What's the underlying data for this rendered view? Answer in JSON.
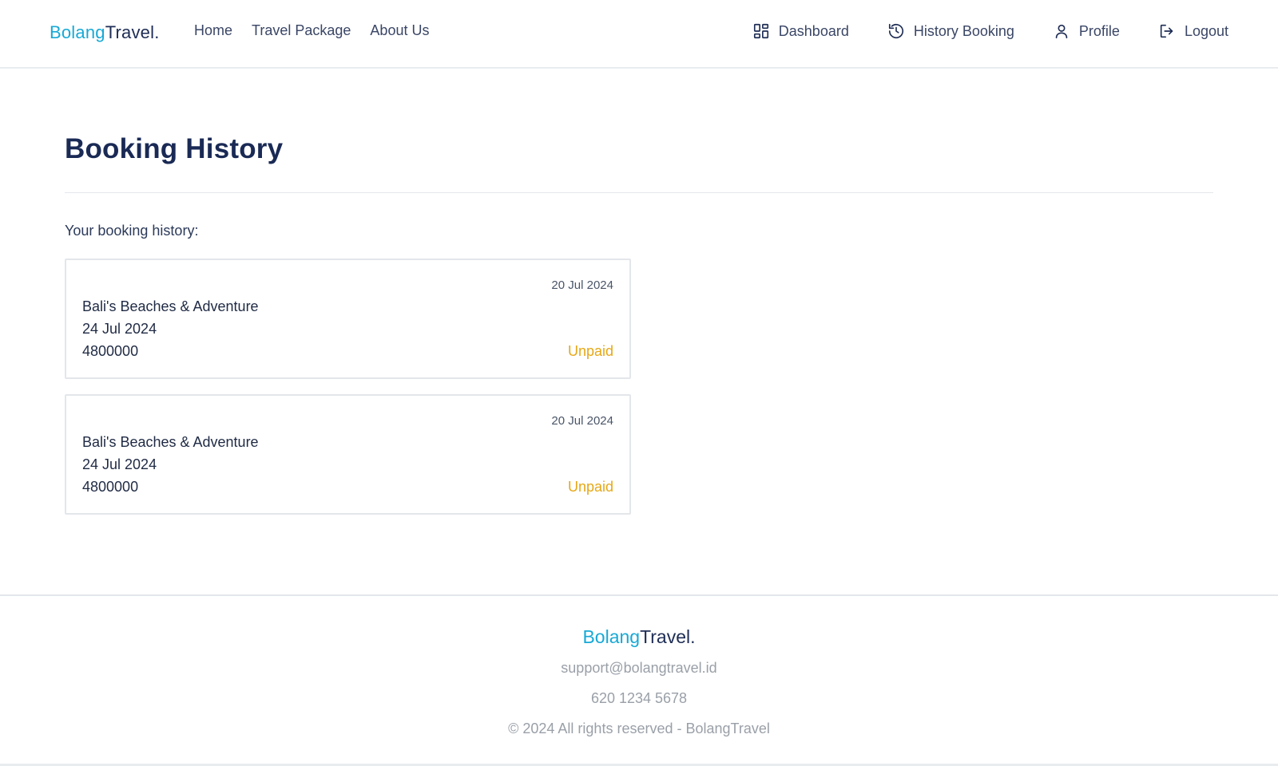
{
  "brand": {
    "part1": "Bolang",
    "part2": "Travel."
  },
  "nav_left": [
    {
      "label": "Home"
    },
    {
      "label": "Travel Package"
    },
    {
      "label": "About Us"
    }
  ],
  "nav_right": [
    {
      "label": "Dashboard",
      "icon": "dashboard-grid-icon"
    },
    {
      "label": "History Booking",
      "icon": "history-icon"
    },
    {
      "label": "Profile",
      "icon": "user-icon"
    },
    {
      "label": "Logout",
      "icon": "logout-icon"
    }
  ],
  "page": {
    "title": "Booking History",
    "subtitle": "Your booking history:"
  },
  "bookings": [
    {
      "booked_on": "20 Jul 2024",
      "package": "Bali's Beaches & Adventure",
      "trip_date": "24 Jul 2024",
      "price": "4800000",
      "status": "Unpaid"
    },
    {
      "booked_on": "20 Jul 2024",
      "package": "Bali's Beaches & Adventure",
      "trip_date": "24 Jul 2024",
      "price": "4800000",
      "status": "Unpaid"
    }
  ],
  "footer": {
    "brand_part1": "Bolang",
    "brand_part2": "Travel.",
    "email": "support@bolangtravel.id",
    "phone": "620 1234 5678",
    "copyright": "© 2024 All rights reserved - BolangTravel"
  },
  "colors": {
    "brand_accent": "#17a9d6",
    "brand_dark": "#1e2d55",
    "status_unpaid": "#e6a817"
  }
}
